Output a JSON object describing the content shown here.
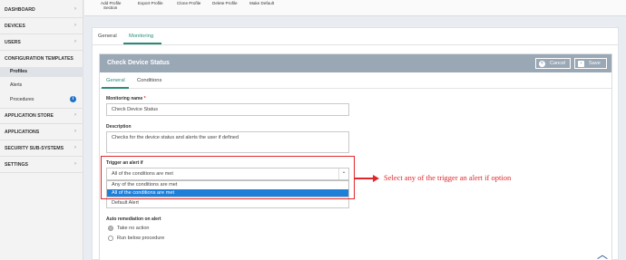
{
  "sidebar": {
    "items": [
      {
        "label": "DASHBOARD"
      },
      {
        "label": "DEVICES"
      },
      {
        "label": "USERS"
      },
      {
        "label": "CONFIGURATION TEMPLATES"
      },
      {
        "label": "Profiles"
      },
      {
        "label": "Alerts"
      },
      {
        "label": "Procedures"
      },
      {
        "label": "APPLICATION STORE"
      },
      {
        "label": "APPLICATIONS"
      },
      {
        "label": "SECURITY SUB-SYSTEMS"
      },
      {
        "label": "SETTINGS"
      }
    ]
  },
  "toolbar": {
    "add_profile_line1": "Add Profile",
    "add_profile_line2": "Section",
    "export": "Export Profile",
    "clone": "Clone Profile",
    "delete": "Delete Profile",
    "make_default": "Make Default"
  },
  "main_tabs": {
    "general": "General",
    "monitoring": "Monitoring"
  },
  "card": {
    "title": "Check Device Status",
    "cancel": "Cancel",
    "save": "Save",
    "sub_tabs": {
      "general": "General",
      "conditions": "Conditions"
    }
  },
  "form": {
    "monitoring_name_label": "Monitoring name",
    "required_mark": "*",
    "monitoring_name_value": "Check Device Status",
    "description_label": "Description",
    "description_value": "Checks for the device status and alerts the user if defined",
    "trigger_label": "Trigger an alert if",
    "trigger_value": "All of the conditions are met",
    "trigger_options": [
      "Any of the conditions are met",
      "All of the conditions are met"
    ],
    "alert_value": "Default Alert",
    "auto_remediation_label": "Auto remediation on alert",
    "radio_options": [
      "Take no action",
      "Run below procedure"
    ]
  },
  "annotation": {
    "text": "Select any of the trigger an alert if option",
    "color": "#e0262a"
  },
  "colors": {
    "accent": "#2a8c78",
    "header": "#9aa8b6",
    "selected_option": "#1e7fd9",
    "info_icon": "#1f73c7"
  }
}
